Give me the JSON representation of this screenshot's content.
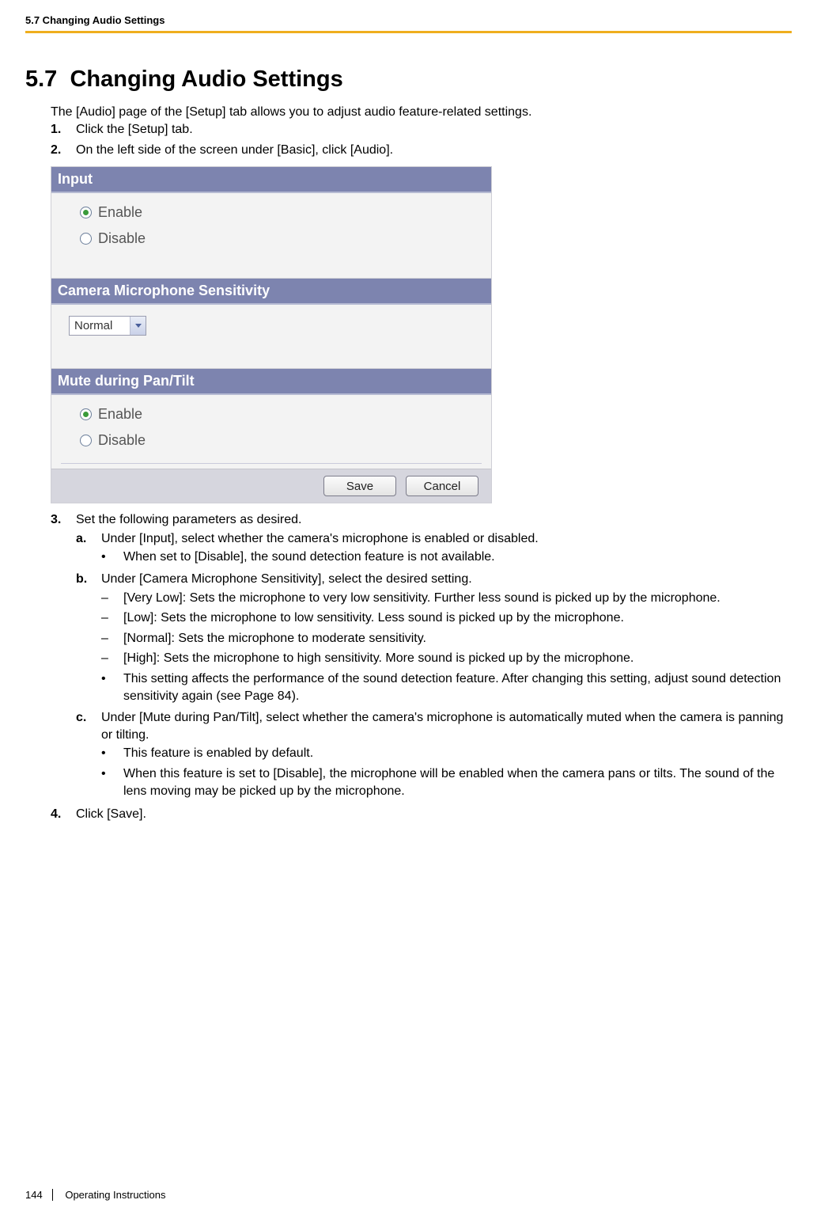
{
  "header": {
    "running": "5.7 Changing Audio Settings"
  },
  "title": {
    "number": "5.7",
    "text": "Changing Audio Settings"
  },
  "intro": "The [Audio] page of the [Setup] tab allows you to adjust audio feature-related settings.",
  "steps": {
    "s1": {
      "marker": "1.",
      "text": "Click the [Setup] tab."
    },
    "s2": {
      "marker": "2.",
      "text": "On the left side of the screen under [Basic], click [Audio]."
    },
    "s3": {
      "marker": "3.",
      "text": "Set the following parameters as desired.",
      "a": {
        "marker": "a.",
        "text": "Under [Input], select whether the camera's microphone is enabled or disabled.",
        "b1": "When set to [Disable], the sound detection feature is not available."
      },
      "b": {
        "marker": "b.",
        "text": "Under [Camera Microphone Sensitivity], select the desired setting.",
        "d1": "[Very Low]: Sets the microphone to very low sensitivity. Further less sound is picked up by the microphone.",
        "d2": "[Low]: Sets the microphone to low sensitivity. Less sound is picked up by the microphone.",
        "d3": "[Normal]: Sets the microphone to moderate sensitivity.",
        "d4": "[High]: Sets the microphone to high sensitivity. More sound is picked up by the microphone.",
        "b1": "This setting affects the performance of the sound detection feature. After changing this setting, adjust sound detection sensitivity again (see Page 84)."
      },
      "c": {
        "marker": "c.",
        "text": "Under [Mute during Pan/Tilt], select whether the camera's microphone is automatically muted when the camera is panning or tilting.",
        "b1": "This feature is enabled by default.",
        "b2": "When this feature is set to [Disable], the microphone will be enabled when the camera pans or tilts. The sound of the lens moving may be picked up by the microphone."
      }
    },
    "s4": {
      "marker": "4.",
      "text": "Click [Save]."
    }
  },
  "panel": {
    "input_header": "Input",
    "input_enable": "Enable",
    "input_disable": "Disable",
    "sens_header": "Camera Microphone Sensitivity",
    "sens_value": "Normal",
    "mute_header": "Mute during Pan/Tilt",
    "mute_enable": "Enable",
    "mute_disable": "Disable",
    "save": "Save",
    "cancel": "Cancel"
  },
  "footer": {
    "page": "144",
    "doc": "Operating Instructions"
  },
  "markers": {
    "bullet": "•",
    "dash": "–"
  }
}
